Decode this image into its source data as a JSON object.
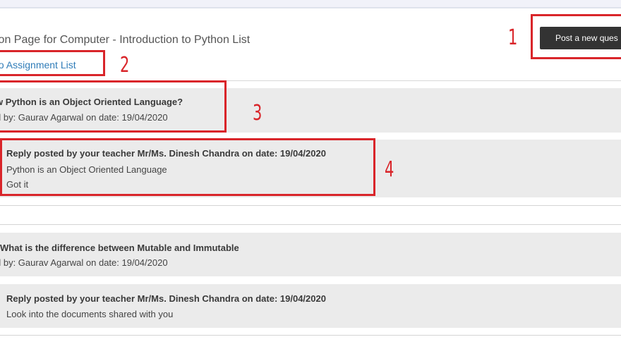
{
  "header": {
    "title": "ion Page for Computer - Introduction to Python List",
    "back_link": "to Assignment List",
    "post_button": "Post a new ques"
  },
  "questions": [
    {
      "title": "w Python is an Object Oriented Language?",
      "meta": "d by: Gaurav Agarwal on date: 19/04/2020",
      "reply": {
        "heading": "Reply posted by your teacher Mr/Ms. Dinesh Chandra on date: 19/04/2020",
        "lines": [
          "Python is an Object Oriented Language",
          "Got it"
        ]
      }
    },
    {
      "title": "What is the difference between Mutable and Immutable",
      "meta": "d by: Gaurav Agarwal on date: 19/04/2020",
      "reply": {
        "heading": "Reply posted by your teacher Mr/Ms. Dinesh Chandra on date: 19/04/2020",
        "lines": [
          "Look into the documents shared with you"
        ]
      }
    }
  ],
  "annotations": [
    "1",
    "2",
    "3",
    "4"
  ],
  "colors": {
    "annotation": "#d9252a",
    "link": "#2f7cb8",
    "button": "#333333"
  }
}
